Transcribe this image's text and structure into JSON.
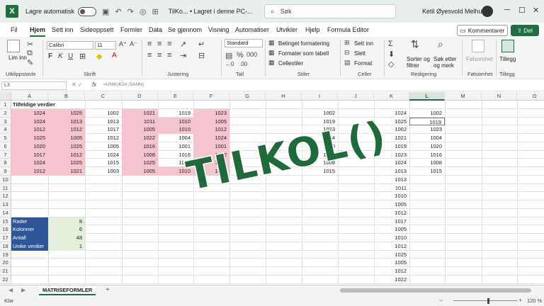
{
  "titlebar": {
    "app_icon": "X",
    "autosave_label": "Lagre automatisk",
    "autosave_state": "off",
    "title": "TilKo... • Lagret i denne PC-...",
    "search_placeholder": "Søk",
    "user": "Ketil Øyesvold Melhus"
  },
  "menu": {
    "tabs": [
      "Fil",
      "Hjem",
      "Sett inn",
      "Sideoppsett",
      "Formler",
      "Data",
      "Se gjennom",
      "Visning",
      "Automatiser",
      "Utvikler",
      "Hjelp",
      "Formula Editor"
    ],
    "active": "Hjem",
    "comments_button": "Kommentarer",
    "share_button": "Del"
  },
  "ribbon": {
    "paste_label": "Lim inn",
    "font_name": "Calibri",
    "font_size": "11",
    "number_format": "Standard",
    "conditional_format": "Betinget formatering",
    "format_as_table": "Formater som tabell",
    "cell_styles": "Cellestiler",
    "insert": "Sett inn",
    "delete": "Slett",
    "format": "Format",
    "sort_filter": "Sorter og filtrer",
    "find_select": "Søk etter og merk",
    "sensitivity": "Følsomhet",
    "addins": "Tillegg",
    "groups": {
      "clipboard": "Utklippstavle",
      "font": "Skrift",
      "alignment": "Justering",
      "number": "Tall",
      "styles": "Stiler",
      "cells": "Celler",
      "editing": "Redigering",
      "sensitivity": "Følsomhet",
      "addins": "Tillegg"
    }
  },
  "formula_bar": {
    "name_box": "L3",
    "formula": "=UNIK(K2#;;SANN)"
  },
  "columns": [
    "A",
    "B",
    "C",
    "D",
    "E",
    "F",
    "G",
    "H",
    "I",
    "J",
    "K",
    "L",
    "M",
    "N",
    "O"
  ],
  "selected_column": "L",
  "rows": [
    "1",
    "2",
    "3",
    "4",
    "5",
    "6",
    "7",
    "8",
    "9",
    "10",
    "11",
    "12",
    "13",
    "14",
    "15",
    "16",
    "17",
    "18",
    "19",
    "20",
    "21",
    "22"
  ],
  "header_cell": "Tilfeldige verdier",
  "table_a": [
    [
      "1024",
      "1025",
      "1002",
      "1021",
      "1019",
      "1023"
    ],
    [
      "1024",
      "1013",
      "1013",
      "1011",
      "1010",
      "1005"
    ],
    [
      "1012",
      "1012",
      "1017",
      "1005",
      "1010",
      "1012"
    ],
    [
      "1025",
      "1005",
      "1012",
      "1022",
      "1004",
      "1024"
    ],
    [
      "1020",
      "1025",
      "1005",
      "1016",
      "1001",
      "1001"
    ],
    [
      "1017",
      "1012",
      "1024",
      "1008",
      "1016",
      "1012"
    ],
    [
      "1024",
      "1025",
      "1015",
      "1025",
      "1010",
      "1021"
    ],
    [
      "1012",
      "1021",
      "1003",
      "1005",
      "1010",
      "1010"
    ]
  ],
  "col_i": [
    "1002",
    "1019",
    "1023",
    "1004",
    "1020",
    "1016",
    "1008",
    "1015"
  ],
  "col_k": [
    "1024",
    "1025",
    "1002",
    "1021",
    "1019",
    "1023",
    "1024",
    "1013",
    "1013",
    "1011",
    "1010",
    "1005",
    "1012",
    "1017",
    "1005",
    "1010",
    "1012",
    "1025",
    "1005",
    "1012",
    "1022"
  ],
  "col_l": [
    "1002",
    "1019",
    "1023",
    "1004",
    "1020",
    "1016",
    "1008",
    "1015"
  ],
  "stats": [
    {
      "label": "Rader",
      "value": "8"
    },
    {
      "label": "Kolonner",
      "value": "6"
    },
    {
      "label": "Antall",
      "value": "48"
    },
    {
      "label": "Unike verdier",
      "value": "1"
    }
  ],
  "overlay_text": "TILKOL()",
  "sheet_tab": "MATRISEFORMLER",
  "status": "Klar",
  "zoom": "120 %",
  "colors": {
    "accent": "#1d6f42",
    "pink": "#f6c4ce",
    "stat_blue": "#2e5597"
  }
}
